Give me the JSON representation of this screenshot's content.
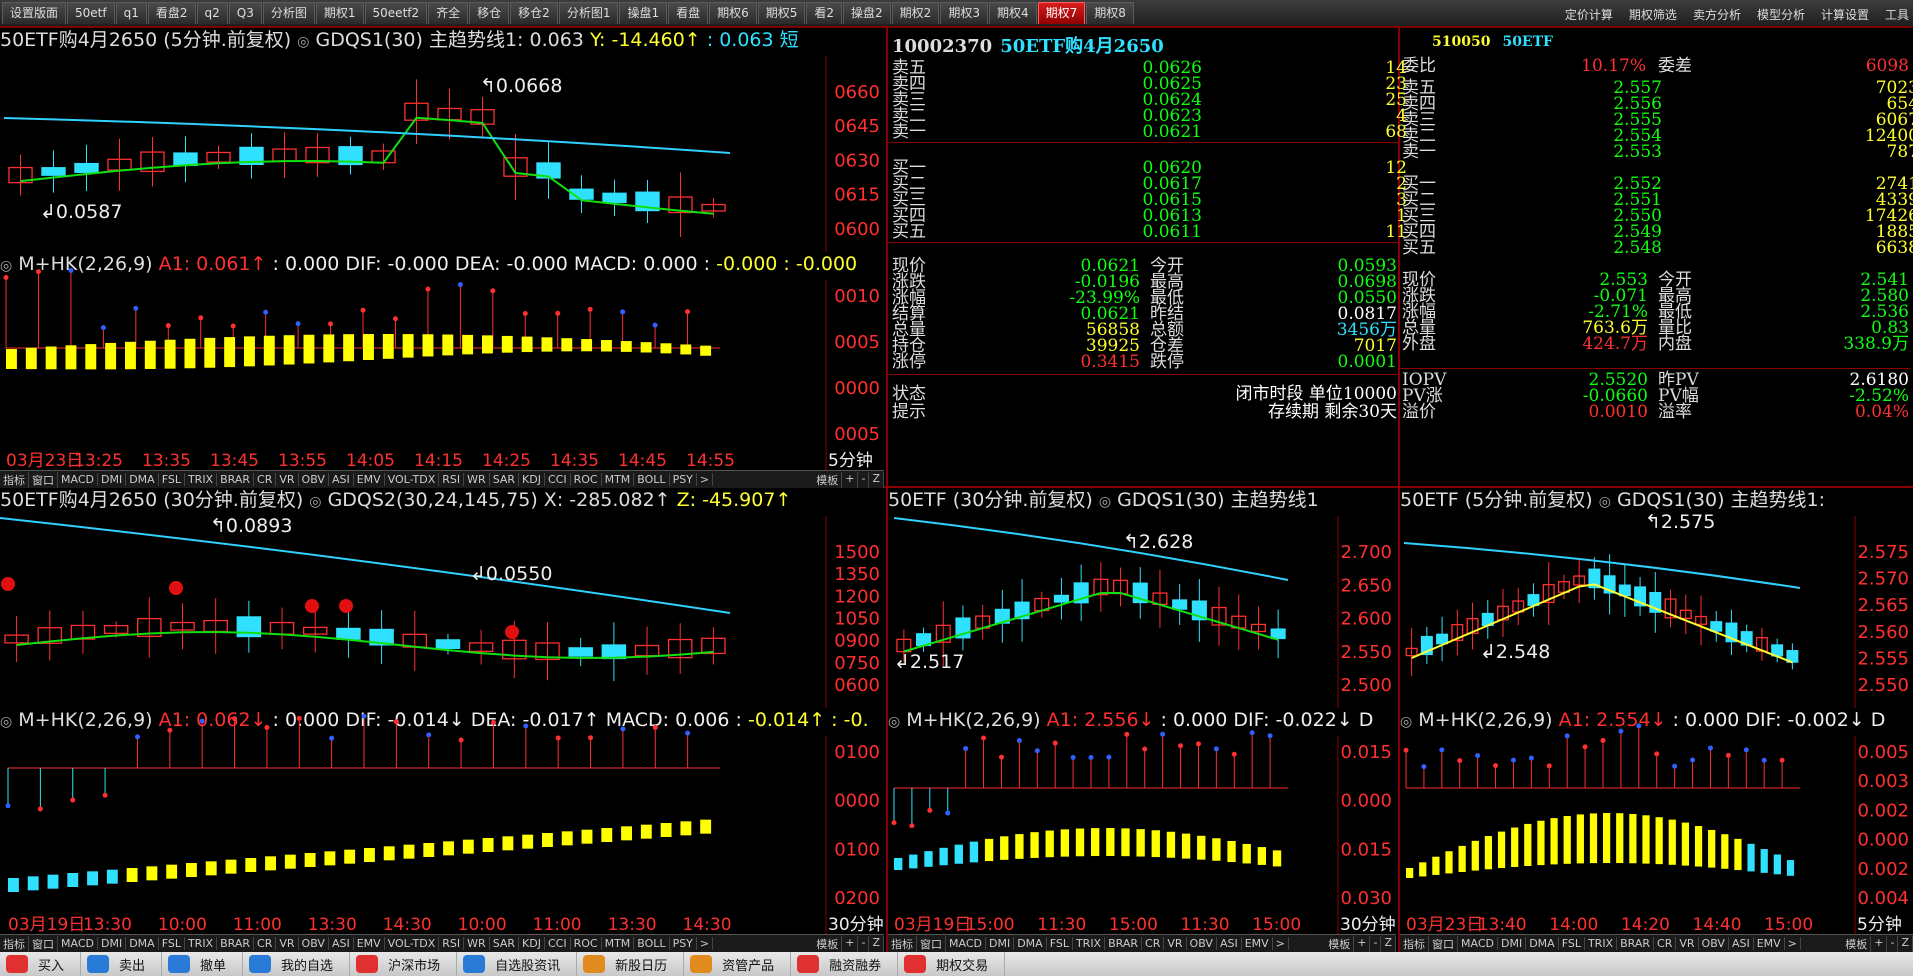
{
  "tabs": [
    {
      "label": "设置版面"
    },
    {
      "label": "50etf"
    },
    {
      "label": "q1"
    },
    {
      "label": "看盘2"
    },
    {
      "label": "q2"
    },
    {
      "label": "Q3"
    },
    {
      "label": "分析图"
    },
    {
      "label": "期权1"
    },
    {
      "label": "50eetf2"
    },
    {
      "label": "齐全"
    },
    {
      "label": "移仓"
    },
    {
      "label": "移仓2"
    },
    {
      "label": "分析图1"
    },
    {
      "label": "操盘1"
    },
    {
      "label": "看盘"
    },
    {
      "label": "期权6"
    },
    {
      "label": "期权5"
    },
    {
      "label": "看2"
    },
    {
      "label": "操盘2"
    },
    {
      "label": "期权2"
    },
    {
      "label": "期权3"
    },
    {
      "label": "期权4"
    },
    {
      "label": "期权7",
      "active": true
    },
    {
      "label": "期权8"
    }
  ],
  "top_menu": [
    "定价计算",
    "期权筛选",
    "卖方分析",
    "模型分析",
    "计算设置",
    "工具"
  ],
  "panel1": {
    "title": "50ETF购4月2650 (5分钟.前复权)",
    "indicator": "GDQS1(30) 主趋势线1: 0.063",
    "y_val": "Y: -14.460↑",
    "extra": ": 0.063 短",
    "axis": [
      "0660",
      "0645",
      "0630",
      "0615",
      "0600"
    ],
    "hi_label": "0.0668",
    "lo_label": "0.0587"
  },
  "panel1_ind": {
    "title": "M+HK(2,26,9)",
    "a1": "A1: 0.061↑",
    "rest": ": 0.000 DIF: -0.000 DEA: -0.000 MACD: 0.000 :",
    "tail": "-0.000 : -0.000",
    "axis": [
      "0010",
      "0005",
      "0000",
      "0005"
    ],
    "xlabels": [
      "03月23日",
      "13:25",
      "13:35",
      "13:45",
      "13:55",
      "14:05",
      "14:15",
      "14:25",
      "14:35",
      "14:45",
      "14:55"
    ],
    "axis_unit": "5分钟"
  },
  "panel2": {
    "title": "50ETF购4月2650 (30分钟.前复权)",
    "indicator": "GDQS2(30,24,145,75) X: -285.082↑",
    "z_val": "Z: -45.907↑",
    "axis": [
      "1500",
      "1350",
      "1200",
      "1050",
      "0900",
      "0750",
      "0600"
    ],
    "hi_label": "0.0893",
    "lo_label": "0.0550"
  },
  "panel2_ind": {
    "title": "M+HK(2,26,9)",
    "a1": "A1: 0.062↓",
    "rest": ": 0.000 DIF: -0.014↓ DEA: -0.017↑ MACD: 0.006 :",
    "tail": "-0.014↑ : -0.",
    "axis": [
      "0100",
      "0000",
      "0100",
      "0200"
    ],
    "xlabels": [
      "03月19日",
      "13:30",
      "10:00",
      "11:00",
      "13:30",
      "14:30",
      "10:00",
      "11:00",
      "13:30",
      "14:30"
    ],
    "axis_unit": "30分钟"
  },
  "panel3": {
    "title": "50ETF (30分钟.前复权)",
    "indicator": "GDQS1(30) 主趋势线1",
    "axis": [
      "2.700",
      "2.650",
      "2.600",
      "2.550",
      "2.500"
    ],
    "hi_label": "2.628",
    "lo_label": "2.517"
  },
  "panel3_ind": {
    "title": "M+HK(2,26,9)",
    "a1": "A1: 2.556↓",
    "rest": ": 0.000 DIF: -0.022↓ D",
    "axis": [
      "0.015",
      "0.000",
      "0.015",
      "0.030"
    ],
    "xlabels": [
      "03月19日",
      "15:00",
      "11:30",
      "15:00",
      "11:30",
      "15:00"
    ],
    "axis_unit": "30分钟"
  },
  "panel4": {
    "title": "50ETF (5分钟.前复权)",
    "indicator": "GDQS1(30) 主趋势线1:",
    "axis": [
      "2.575",
      "2.570",
      "2.565",
      "2.560",
      "2.555",
      "2.550"
    ],
    "hi_label": "2.575",
    "lo_label": "2.548"
  },
  "panel4_ind": {
    "title": "M+HK(2,26,9)",
    "a1": "A1: 2.554↓",
    "rest": ": 0.000 DIF: -0.002↓ D",
    "axis": [
      "0.005",
      "0.003",
      "0.002",
      "0.000",
      "0.002",
      "0.004"
    ],
    "xlabels": [
      "03月23日",
      "13:40",
      "14:00",
      "14:20",
      "14:40",
      "15:00"
    ],
    "axis_unit": "5分钟"
  },
  "indicator_tabs": [
    "指标",
    "窗口",
    "MACD",
    "DMI",
    "DMA",
    "FSL",
    "TRIX",
    "BRAR",
    "CR",
    "VR",
    "OBV",
    "ASI",
    "EMV",
    "VOL-TDX",
    "RSI",
    "WR",
    "SAR",
    "KDJ",
    "CCI",
    "ROC",
    "MTM",
    "BOLL",
    "PSY"
  ],
  "indicator_tabs_short": [
    "指标",
    "窗口",
    "MACD",
    "DMI",
    "DMA",
    "FSL",
    "TRIX",
    "BRAR",
    "CR",
    "VR",
    "OBV",
    "ASI",
    "EMV"
  ],
  "strip_controls": [
    "模板",
    "+",
    "-",
    "Z"
  ],
  "quote_left": {
    "code": "10002370",
    "name": "50ETF购4月2650",
    "asks": [
      {
        "label": "卖五",
        "price": "0.0626",
        "vol": "14"
      },
      {
        "label": "卖四",
        "price": "0.0625",
        "vol": "23"
      },
      {
        "label": "卖三",
        "price": "0.0624",
        "vol": "25"
      },
      {
        "label": "卖二",
        "price": "0.0623",
        "vol": "4"
      },
      {
        "label": "卖一",
        "price": "0.0621",
        "vol": "68"
      }
    ],
    "bids": [
      {
        "label": "买一",
        "price": "0.0620",
        "vol": "12"
      },
      {
        "label": "买二",
        "price": "0.0617",
        "vol": "2"
      },
      {
        "label": "买三",
        "price": "0.0615",
        "vol": "3"
      },
      {
        "label": "买四",
        "price": "0.0613",
        "vol": "1"
      },
      {
        "label": "买五",
        "price": "0.0611",
        "vol": "11"
      }
    ],
    "stats": [
      {
        "l1": "现价",
        "v1": "0.0621",
        "c1": "g",
        "l2": "今开",
        "v2": "0.0593",
        "c2": "g"
      },
      {
        "l1": "涨跌",
        "v1": "-0.0196",
        "c1": "g",
        "l2": "最高",
        "v2": "0.0698",
        "c2": "g"
      },
      {
        "l1": "涨幅",
        "v1": "-23.99%",
        "c1": "g",
        "l2": "最低",
        "v2": "0.0550",
        "c2": "g"
      },
      {
        "l1": "结算",
        "v1": "0.0621",
        "c1": "g",
        "l2": "昨结",
        "v2": "0.0817",
        "c2": "wh"
      },
      {
        "l1": "总量",
        "v1": "56858",
        "c1": "yel",
        "l2": "总额",
        "v2": "3456万",
        "c2": "cy"
      },
      {
        "l1": "持仓",
        "v1": "39925",
        "c1": "yel",
        "l2": "仓差",
        "v2": "7017",
        "c2": "yel"
      },
      {
        "l1": "涨停",
        "v1": "0.3415",
        "c1": "red",
        "l2": "跌停",
        "v2": "0.0001",
        "c2": "g"
      }
    ],
    "status_label": "状态",
    "status_value": "闭市时段 单位10000",
    "hint_label": "提示",
    "hint_value": "存续期 剩余30天"
  },
  "quote_right": {
    "code": "510050",
    "name": "50ETF",
    "weibi_label": "委比",
    "weibi": "10.17%",
    "weicha_label": "委差",
    "weicha": "6098",
    "asks": [
      {
        "label": "卖五",
        "price": "2.557",
        "vol": "7023"
      },
      {
        "label": "卖四",
        "price": "2.556",
        "vol": "654"
      },
      {
        "label": "卖三",
        "price": "2.555",
        "vol": "6067"
      },
      {
        "label": "卖二",
        "price": "2.554",
        "vol": "12400"
      },
      {
        "label": "卖一",
        "price": "2.553",
        "vol": "787"
      }
    ],
    "bids": [
      {
        "label": "买一",
        "price": "2.552",
        "vol": "2741"
      },
      {
        "label": "买二",
        "price": "2.551",
        "vol": "4339"
      },
      {
        "label": "买三",
        "price": "2.550",
        "vol": "17426"
      },
      {
        "label": "买四",
        "price": "2.549",
        "vol": "1885"
      },
      {
        "label": "买五",
        "price": "2.548",
        "vol": "6638"
      }
    ],
    "stats": [
      {
        "l1": "现价",
        "v1": "2.553",
        "c1": "g",
        "l2": "今开",
        "v2": "2.541",
        "c2": "g"
      },
      {
        "l1": "涨跌",
        "v1": "-0.071",
        "c1": "g",
        "l2": "最高",
        "v2": "2.580",
        "c2": "g"
      },
      {
        "l1": "涨幅",
        "v1": "-2.71%",
        "c1": "g",
        "l2": "最低",
        "v2": "2.536",
        "c2": "g"
      },
      {
        "l1": "总量",
        "v1": "763.6万",
        "c1": "yel",
        "l2": "量比",
        "v2": "0.83",
        "c2": "g"
      },
      {
        "l1": "外盘",
        "v1": "424.7万",
        "c1": "red",
        "l2": "内盘",
        "v2": "338.9万",
        "c2": "g"
      }
    ],
    "extra": [
      {
        "l1": "IOPV",
        "v1": "2.5520",
        "c1": "g",
        "l2": "昨PV",
        "v2": "2.6180",
        "c2": "wh"
      },
      {
        "l1": "PV涨",
        "v1": "-0.0660",
        "c1": "g",
        "l2": "PV幅",
        "v2": "-2.52%",
        "c2": "g"
      },
      {
        "l1": "溢价",
        "v1": "0.0010",
        "c1": "red",
        "l2": "溢率",
        "v2": "0.04%",
        "c2": "red"
      }
    ]
  },
  "bottom_bar": [
    {
      "label": "买入",
      "icon": "buy-icon",
      "color": "#e03030"
    },
    {
      "label": "卖出",
      "icon": "sell-icon",
      "color": "#2a7ad8"
    },
    {
      "label": "撤单",
      "icon": "cancel-order-icon",
      "color": "#2a7ad8"
    },
    {
      "label": "我的自选",
      "icon": "favorites-icon",
      "color": "#2a7ad8"
    },
    {
      "label": "沪深市场",
      "icon": "market-icon",
      "color": "#e03030"
    },
    {
      "label": "自选股资讯",
      "icon": "news-icon",
      "color": "#2a7ad8"
    },
    {
      "label": "新股日历",
      "icon": "calendar-icon",
      "color": "#e08a20"
    },
    {
      "label": "资管产品",
      "icon": "asset-icon",
      "color": "#e08a20"
    },
    {
      "label": "融资融券",
      "icon": "margin-icon",
      "color": "#e03030"
    },
    {
      "label": "期权交易",
      "icon": "option-trade-icon",
      "color": "#e03030"
    }
  ],
  "colors": {
    "up": "#ff3030",
    "down": "#30e0ff",
    "ma_green": "#10e010",
    "ma_cyan": "#30d0ff",
    "macd_yellow": "#ffff00",
    "grid_red": "#8a0000"
  }
}
